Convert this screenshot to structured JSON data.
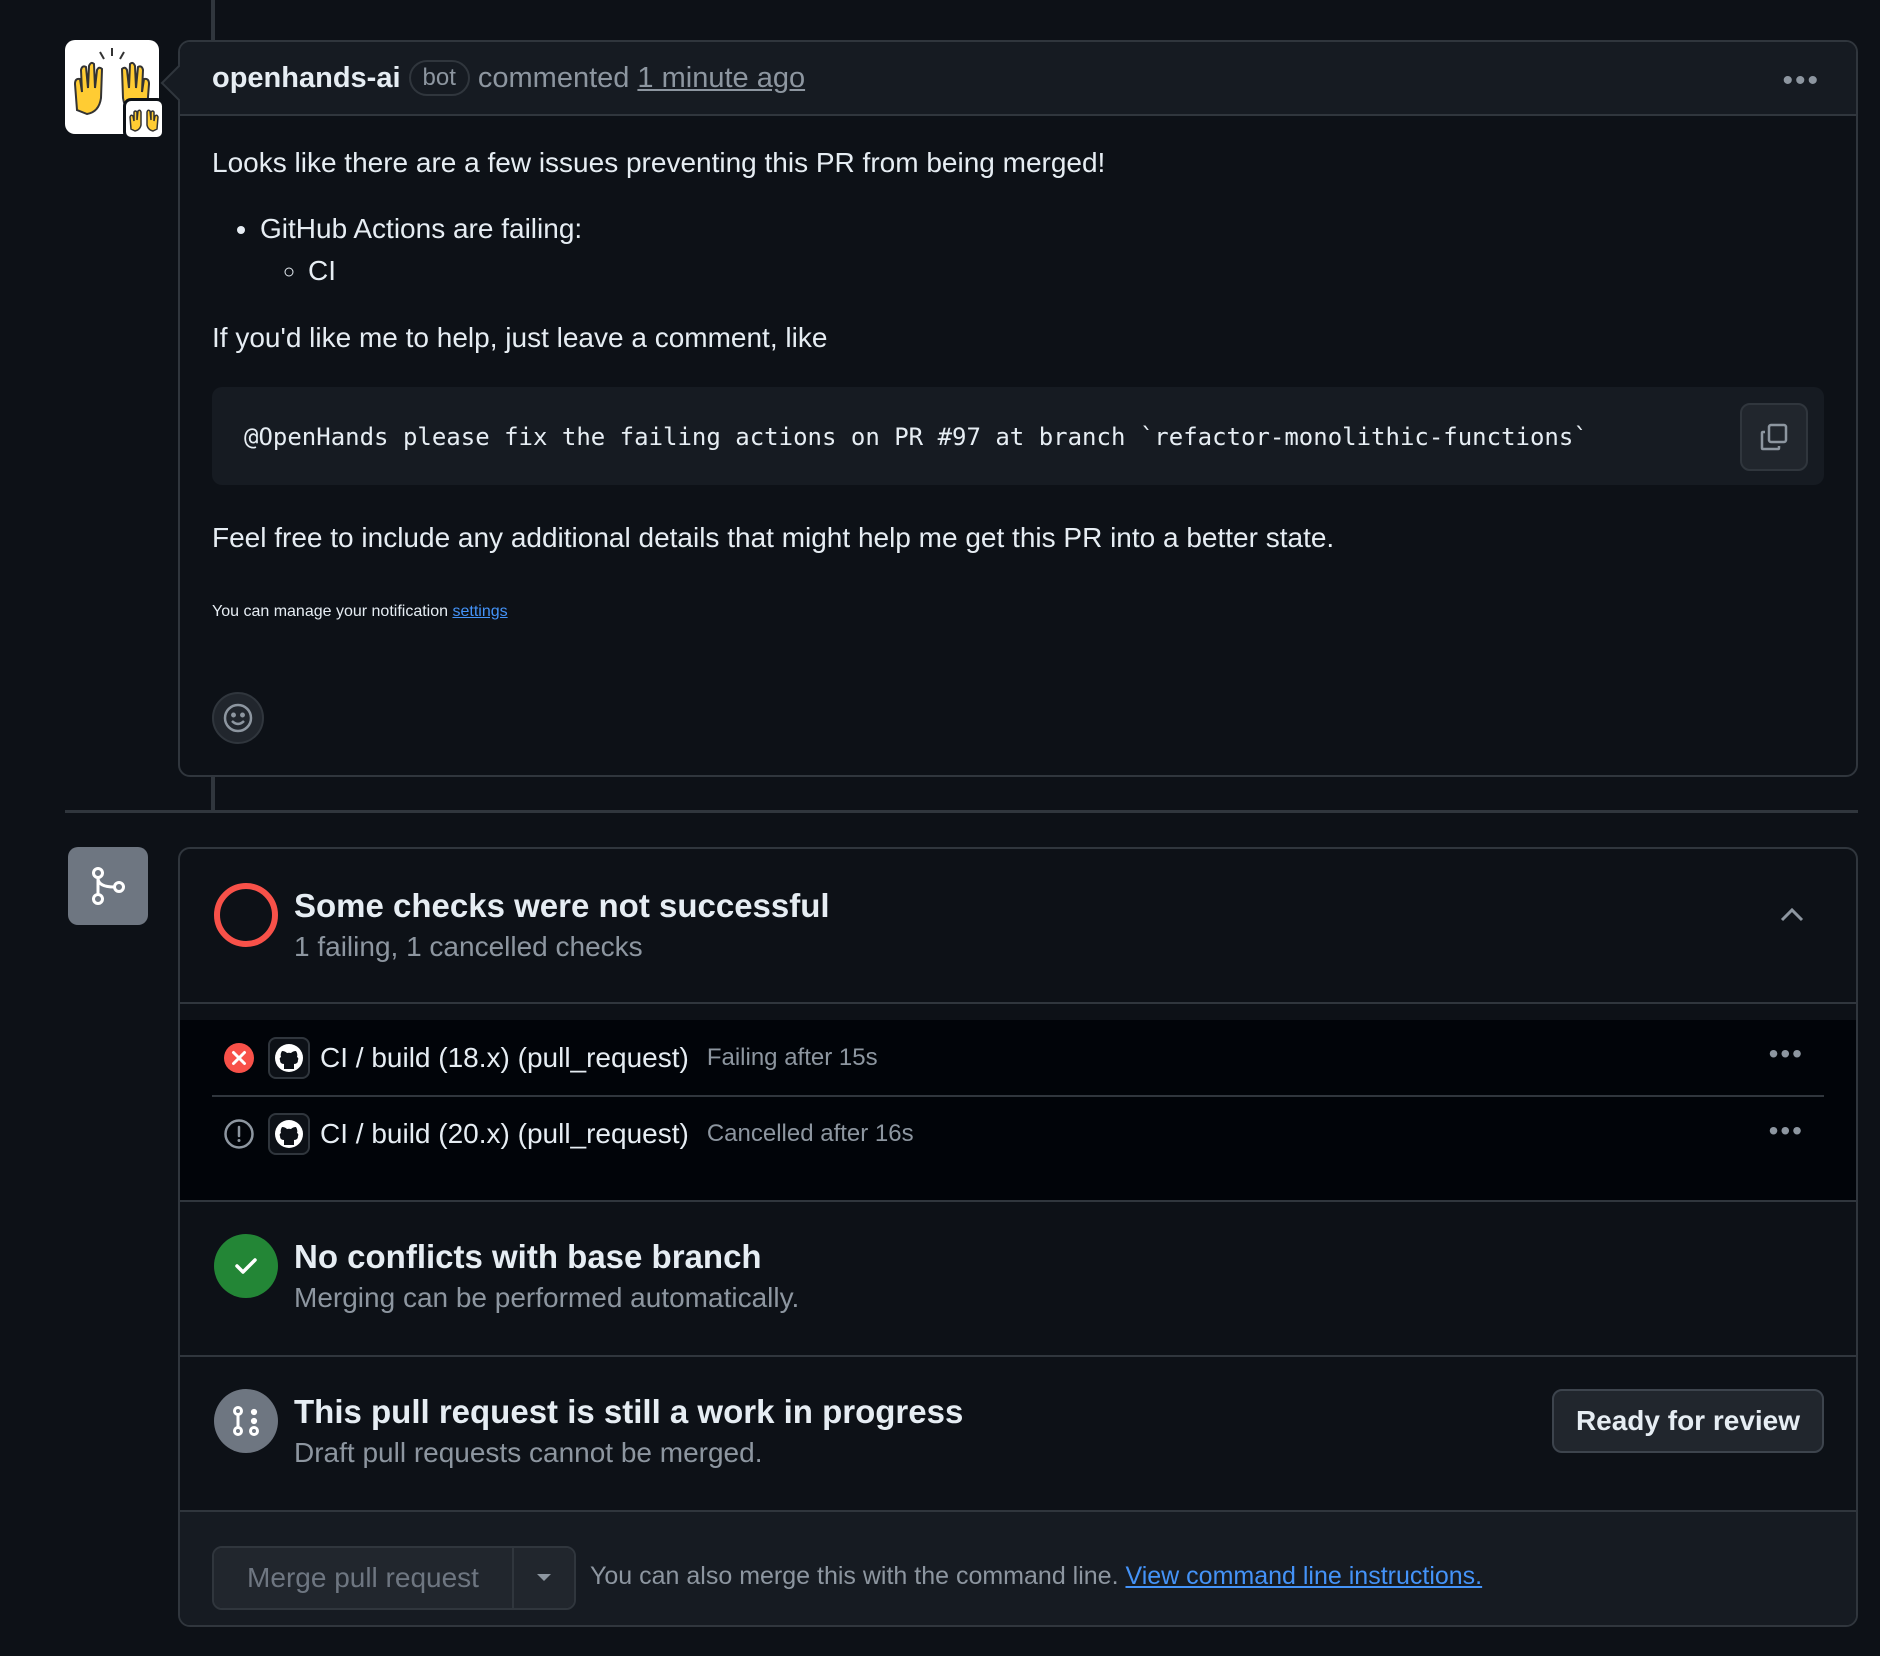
{
  "comment": {
    "author": "openhands-ai",
    "badge": "bot",
    "action": "commented",
    "time": "1 minute ago",
    "intro": "Looks like there are a few issues preventing this PR from being merged!",
    "bullet": "GitHub Actions are failing:",
    "sub_bullet": "CI",
    "help": "If you'd like me to help, just leave a comment, like",
    "code": "@OpenHands please fix the failing actions on PR #97 at branch `refactor-monolithic-functions`",
    "closing": "Feel free to include any additional details that might help me get this PR into a better state.",
    "note_prefix": "You can manage your notification",
    "note_link": "settings"
  },
  "checks": {
    "title": "Some checks were not successful",
    "subtitle": "1 failing, 1 cancelled checks",
    "rows": [
      {
        "name": "CI / build (18.x) (pull_request)",
        "status": "Failing after 15s",
        "state": "failed"
      },
      {
        "name": "CI / build (20.x) (pull_request)",
        "status": "Cancelled after 16s",
        "state": "cancelled"
      }
    ]
  },
  "conflicts": {
    "title": "No conflicts with base branch",
    "subtitle": "Merging can be performed automatically."
  },
  "wip": {
    "title": "This pull request is still a work in progress",
    "subtitle": "Draft pull requests cannot be merged.",
    "button": "Ready for review"
  },
  "merge": {
    "button": "Merge pull request",
    "note": "You can also merge this with the command line.",
    "link": "View command line instructions."
  },
  "colors": {
    "background": "#0d1117",
    "border": "#30363d",
    "danger": "#f85149",
    "success": "#238636",
    "link": "#4493f8",
    "muted": "#8d96a0"
  }
}
